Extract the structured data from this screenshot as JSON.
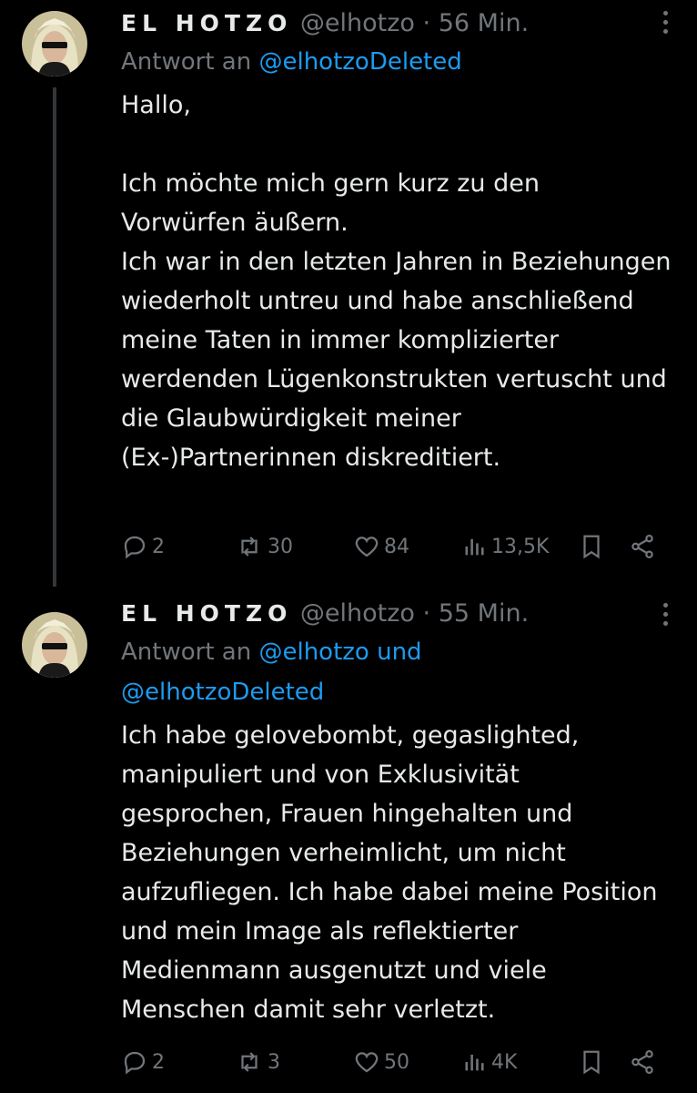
{
  "tweets": [
    {
      "name": "EL HOTZO",
      "handle": "@elhotzo",
      "separator": "·",
      "time": "56 Min.",
      "reply_prefix": "Antwort an",
      "reply_line1": "@elhotzoDeleted",
      "reply_line2": "",
      "paragraphs": [
        "Hallo,",
        "",
        "Ich möchte mich gern kurz zu den Vorwürfen äußern.",
        "Ich war in den letzten Jahren in Beziehungen wiederholt untreu und habe anschließend meine Taten in immer komplizierter werdenden Lügenkonstrukten vertuscht und die Glaubwürdigkeit meiner (Ex-)Partnerinnen diskreditiert."
      ],
      "replies": "2",
      "reposts": "30",
      "likes": "84",
      "views": "13,5K"
    },
    {
      "name": "EL HOTZO",
      "handle": "@elhotzo",
      "separator": "·",
      "time": "55 Min.",
      "reply_prefix": "Antwort an",
      "reply_line1": "@elhotzo und",
      "reply_line2": "@elhotzoDeleted",
      "paragraphs": [
        "Ich habe gelovebombt, gegaslighted, manipuliert und von Exklusivität gesprochen, Frauen hingehalten und Beziehungen verheimlicht, um nicht aufzufliegen. Ich habe dabei meine Position und mein Image als reflektierter Medienmann ausgenutzt und viele Menschen damit sehr verletzt."
      ],
      "replies": "2",
      "reposts": "3",
      "likes": "50",
      "views": "4K"
    }
  ],
  "icons": {
    "reply": "reply-icon",
    "repost": "repost-icon",
    "like": "heart-icon",
    "views": "views-icon",
    "bookmark": "bookmark-icon",
    "share": "share-icon",
    "more": "more-icon"
  },
  "colors": {
    "background": "#000000",
    "text": "#e7e9ea",
    "muted": "#71767b",
    "link": "#1d9bf0"
  }
}
